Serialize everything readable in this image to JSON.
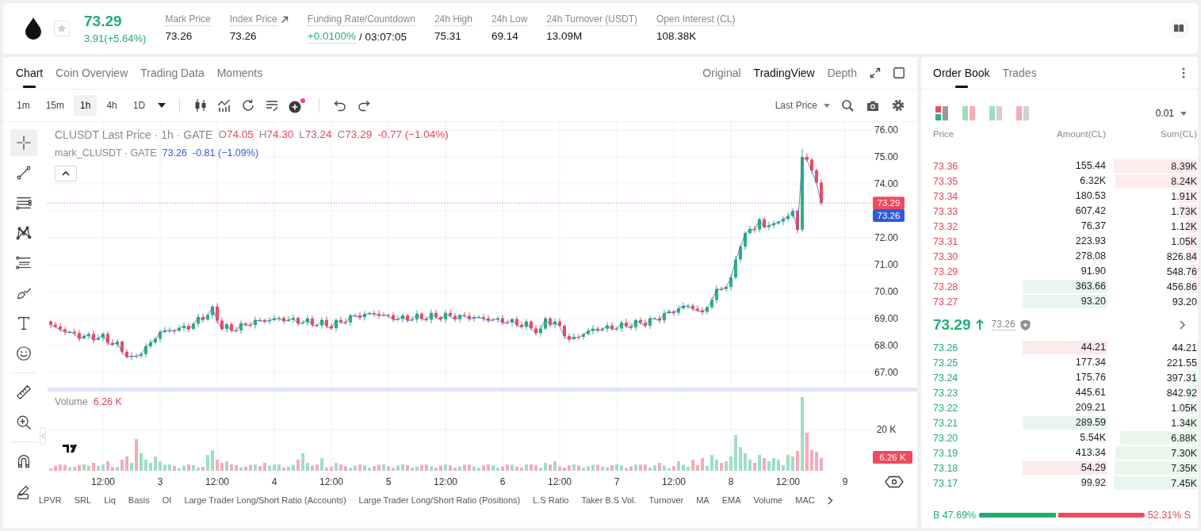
{
  "header": {
    "favorite": false,
    "price": "73.29",
    "change": "3.91(+5.64%)",
    "stats": [
      {
        "kind": "plain",
        "label": "Mark Price",
        "value": "73.26"
      },
      {
        "kind": "link",
        "label": "Index Price",
        "value": "73.26"
      },
      {
        "kind": "funding",
        "label": "Funding Rate/Countdown",
        "rate": "+0.0100%",
        "value": "/ 03:07:05"
      },
      {
        "kind": "plain",
        "label": "24h High",
        "value": "75.31"
      },
      {
        "kind": "plain",
        "label": "24h Low",
        "value": "69.14"
      },
      {
        "kind": "plain",
        "label": "24h Turnover (USDT)",
        "value": "13.09M"
      },
      {
        "kind": "plain",
        "label": "Open Interest (CL)",
        "value": "108.38K"
      }
    ]
  },
  "chart_panel": {
    "tabs": [
      {
        "label": "Chart",
        "selected": true
      },
      {
        "label": "Coin Overview",
        "selected": false
      },
      {
        "label": "Trading Data",
        "selected": false
      },
      {
        "label": "Moments",
        "selected": false
      }
    ],
    "views": [
      {
        "label": "Original",
        "selected": false
      },
      {
        "label": "TradingView",
        "selected": true
      },
      {
        "label": "Depth",
        "selected": false
      }
    ],
    "intervals": [
      {
        "label": "1m",
        "selected": false
      },
      {
        "label": "15m",
        "selected": false
      },
      {
        "label": "1h",
        "selected": true
      },
      {
        "label": "4h",
        "selected": false
      },
      {
        "label": "1D",
        "selected": false
      }
    ],
    "price_source": "Last Price",
    "drawing_tool_groups": [
      {
        "tools": [
          {
            "kind": "crosshair",
            "selected": true
          },
          {
            "kind": "trend_line",
            "selected": false
          },
          {
            "kind": "parallel_lines",
            "selected": false
          },
          {
            "kind": "pattern",
            "selected": false
          },
          {
            "kind": "fib",
            "selected": false
          },
          {
            "kind": "brush",
            "selected": false
          },
          {
            "kind": "text",
            "selected": false
          },
          {
            "kind": "emoji",
            "selected": false
          }
        ]
      },
      {
        "tools": [
          {
            "kind": "ruler",
            "selected": false
          },
          {
            "kind": "zoom",
            "selected": false
          }
        ]
      },
      {
        "tools": [
          {
            "kind": "magnet",
            "selected": false
          },
          {
            "kind": "pencil",
            "selected": false
          }
        ]
      }
    ],
    "legend": {
      "title": "CLUSDT Last Price · 1h · GATE",
      "ohlc": [
        {
          "key": "O",
          "value": "74.05"
        },
        {
          "key": "H",
          "value": "74.30"
        },
        {
          "key": "L",
          "value": "73.24"
        },
        {
          "key": "C",
          "value": "73.29"
        }
      ],
      "change": "-0.77 (−1.04%)",
      "mark_title": "mark_CLUSDT · GATE",
      "mark_value": "73.26",
      "mark_change": "-0.81 (−1.09%)"
    },
    "price_axis_upper": [
      "76.00",
      "75.00",
      "74.00"
    ],
    "price_axis_lower": [
      "72.00",
      "71.00",
      "70.00",
      "69.00",
      "68.00",
      "67.00"
    ],
    "last_price_label": "73.29",
    "mark_price_label": "73.26",
    "volume": {
      "title": "Volume",
      "value": "6.26 K",
      "axis_label": "20 K",
      "last_label": "6.26 K"
    },
    "time_axis": [
      "12:00",
      "3",
      "12:00",
      "4",
      "12:00",
      "5",
      "12:00",
      "6",
      "12:00",
      "7",
      "12:00",
      "8",
      "12:00",
      "9"
    ],
    "indicators": [
      "LPVR",
      "SRL",
      "Liq",
      "Basis",
      "OI",
      "Large Trader Long/Short Ratio (Accounts)",
      "Large Trader Long/Short Ratio (Positions)",
      "L.S Ratio",
      "Taker B.S Vol.",
      "Turnover",
      "MA",
      "EMA",
      "Volume",
      "MAC"
    ]
  },
  "order_book": {
    "tabs": [
      {
        "label": "Order Book",
        "selected": true
      },
      {
        "label": "Trades",
        "selected": false
      }
    ],
    "layouts": [
      {
        "kind": "both",
        "selected": true
      },
      {
        "kind": "split",
        "selected": false
      },
      {
        "kind": "bids",
        "selected": false
      },
      {
        "kind": "asks",
        "selected": false
      }
    ],
    "precision": "0.01",
    "columns": [
      "Price",
      "Amount(CL)",
      "Sum(CL)"
    ],
    "asks": [
      {
        "kind": "plain",
        "price": "73.36",
        "amount": "155.44",
        "sum": "8.39K",
        "level": 1.0
      },
      {
        "kind": "plain",
        "price": "73.35",
        "amount": "6.32K",
        "sum": "8.24K",
        "level": 0.98
      },
      {
        "kind": "plain",
        "price": "73.34",
        "amount": "180.53",
        "sum": "1.91K",
        "level": 0.23
      },
      {
        "kind": "plain",
        "price": "73.33",
        "amount": "607.42",
        "sum": "1.73K",
        "level": 0.21
      },
      {
        "kind": "plain",
        "price": "73.32",
        "amount": "76.37",
        "sum": "1.12K",
        "level": 0.13
      },
      {
        "kind": "plain",
        "price": "73.31",
        "amount": "223.93",
        "sum": "1.05K",
        "level": 0.12
      },
      {
        "kind": "plain",
        "price": "73.30",
        "amount": "278.08",
        "sum": "826.84",
        "level": 0.1
      },
      {
        "kind": "plain",
        "price": "73.29",
        "amount": "91.90",
        "sum": "548.76",
        "level": 0.065
      },
      {
        "kind": "buy_flash",
        "price": "73.28",
        "amount": "363.66",
        "sum": "456.86",
        "level": 0.054
      },
      {
        "kind": "buy_flash",
        "price": "73.27",
        "amount": "93.20",
        "sum": "93.20",
        "level": 0.011
      }
    ],
    "last_price": "73.29",
    "rising": true,
    "mark_price": "73.26",
    "bids": [
      {
        "kind": "sell_flash",
        "price": "73.26",
        "amount": "44.21",
        "sum": "44.21",
        "level": 0.006
      },
      {
        "kind": "plain",
        "price": "73.25",
        "amount": "177.34",
        "sum": "221.55",
        "level": 0.03
      },
      {
        "kind": "plain",
        "price": "73.24",
        "amount": "175.76",
        "sum": "397.31",
        "level": 0.053
      },
      {
        "kind": "plain",
        "price": "73.23",
        "amount": "445.61",
        "sum": "842.92",
        "level": 0.113
      },
      {
        "kind": "plain",
        "price": "73.22",
        "amount": "209.21",
        "sum": "1.05K",
        "level": 0.14
      },
      {
        "kind": "buy_flash",
        "price": "73.21",
        "amount": "289.59",
        "sum": "1.34K",
        "level": 0.18
      },
      {
        "kind": "plain",
        "price": "73.20",
        "amount": "5.54K",
        "sum": "6.88K",
        "level": 0.92
      },
      {
        "kind": "plain",
        "price": "73.19",
        "amount": "413.34",
        "sum": "7.30K",
        "level": 0.98
      },
      {
        "kind": "sell_flash",
        "price": "73.18",
        "amount": "54.29",
        "sum": "7.35K",
        "level": 0.99
      },
      {
        "kind": "plain",
        "price": "73.17",
        "amount": "99.92",
        "sum": "7.45K",
        "level": 1.0
      }
    ],
    "ratio": {
      "buy_label": "B",
      "buy": "47.69%",
      "sell": "52.31%",
      "sell_label": "S",
      "level": 0.4769
    }
  }
}
